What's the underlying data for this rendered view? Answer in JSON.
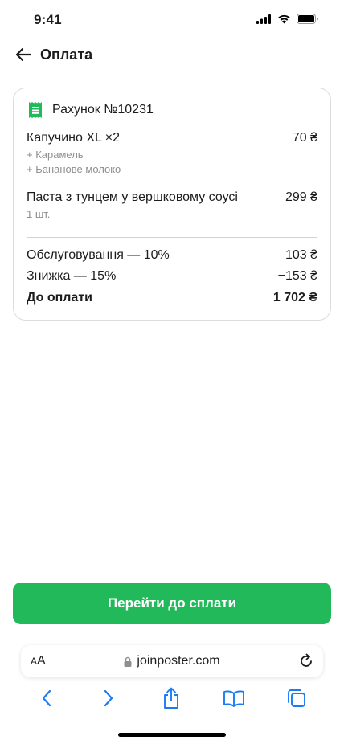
{
  "status_bar": {
    "time": "9:41"
  },
  "header": {
    "title": "Оплата"
  },
  "receipt": {
    "title": "Рахунок №10231",
    "items": [
      {
        "name": "Капучино XL ×2",
        "price": "70 ₴",
        "modifiers": [
          "+ Карамель",
          "+ Бананове молоко"
        ]
      },
      {
        "name": "Паста з тунцем у вершковому соусі",
        "price": "299 ₴",
        "modifiers": [
          "1 шт."
        ]
      }
    ],
    "service": {
      "label": "Обслуговування — 10%",
      "value": "103 ₴"
    },
    "discount": {
      "label": "Знижка — 15%",
      "value": "−153 ₴"
    },
    "total": {
      "label": "До оплати",
      "value": "1 702 ₴"
    }
  },
  "pay_button": {
    "label": "Перейти до сплати"
  },
  "browser": {
    "aa_small": "A",
    "aa_large": "A",
    "url": "joinposter.com"
  },
  "colors": {
    "accent": "#21b95a",
    "browser_blue": "#1a7cf5"
  }
}
